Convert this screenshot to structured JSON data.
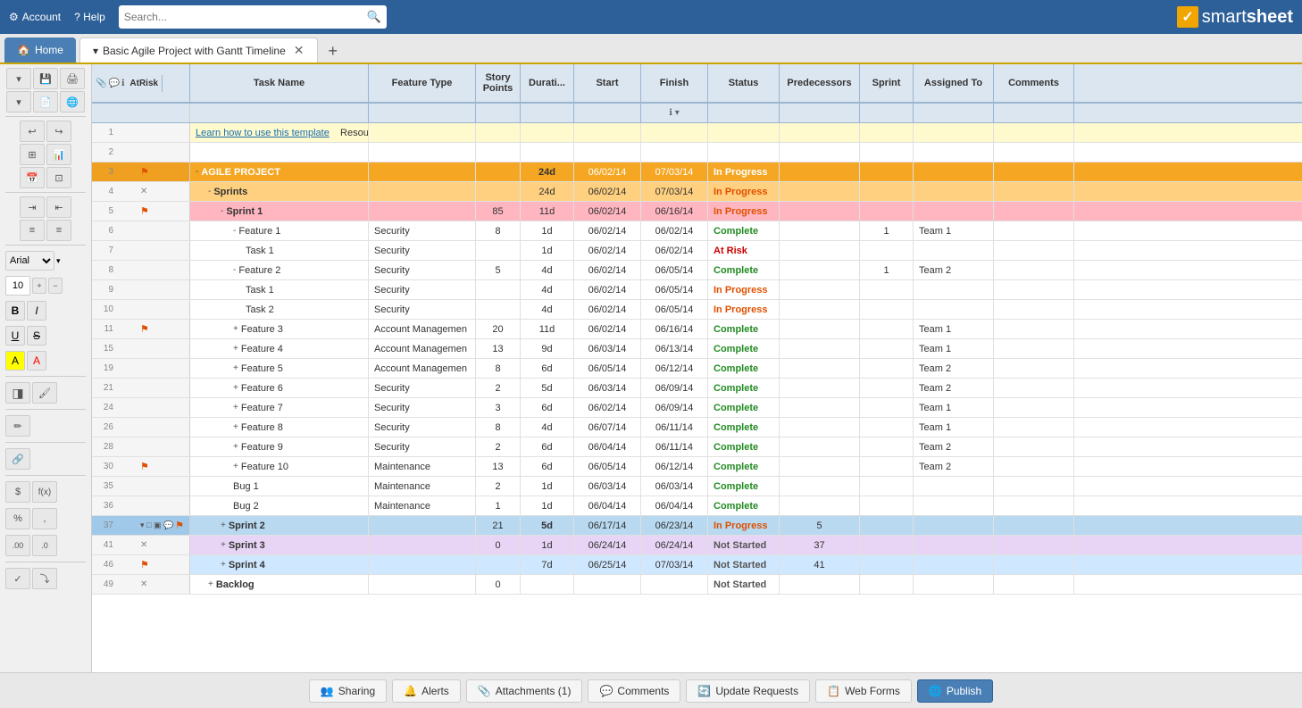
{
  "topbar": {
    "account_label": "Account",
    "help_label": "? Help",
    "search_placeholder": "Search...",
    "logo_text": "smartsheet",
    "logo_check": "✓"
  },
  "tabs": {
    "home_label": "Home",
    "sheet_label": "Basic Agile Project with Gantt Timeline",
    "add_label": "+"
  },
  "columns": {
    "at_risk": "At Risk",
    "task_name": "Task Name",
    "feature_type": "Feature Type",
    "story_points": "Story Points",
    "duration": "Durati...",
    "start": "Start",
    "finish": "Finish",
    "status": "Status",
    "predecessors": "Predecessors",
    "sprint": "Sprint",
    "assigned_to": "Assigned To",
    "comments": "Comments"
  },
  "rows": [
    {
      "num": 1,
      "indent": 0,
      "flag": false,
      "asterisk": false,
      "task": "Learn how to use this template",
      "task_link": true,
      "extra": "Resources",
      "feature": "",
      "story": "",
      "duration": "",
      "start": "",
      "finish": "",
      "status": "",
      "pred": "",
      "sprint": "",
      "assigned": "",
      "comments": "",
      "bg": "yellow"
    },
    {
      "num": 2,
      "indent": 0,
      "flag": false,
      "asterisk": false,
      "task": "",
      "feature": "",
      "story": "",
      "duration": "",
      "start": "",
      "finish": "",
      "status": "",
      "pred": "",
      "sprint": "",
      "assigned": "",
      "comments": "",
      "bg": ""
    },
    {
      "num": 3,
      "indent": 0,
      "flag": true,
      "asterisk": false,
      "task": "AGILE PROJECT",
      "expand": "-",
      "feature": "",
      "story": "",
      "duration": "24d",
      "start": "06/02/14",
      "finish": "07/03/14",
      "status": "In Progress",
      "pred": "",
      "sprint": "",
      "assigned": "",
      "comments": "",
      "bg": "orange"
    },
    {
      "num": 4,
      "indent": 1,
      "flag": false,
      "asterisk": true,
      "task": "Sprints",
      "expand": "-",
      "feature": "",
      "story": "",
      "duration": "24d",
      "start": "06/02/14",
      "finish": "07/03/14",
      "status": "In Progress",
      "pred": "",
      "sprint": "",
      "assigned": "",
      "comments": "",
      "bg": "orange-light"
    },
    {
      "num": 5,
      "indent": 2,
      "flag": true,
      "asterisk": false,
      "task": "Sprint 1",
      "expand": "-",
      "feature": "",
      "story": "85",
      "duration": "11d",
      "start": "06/02/14",
      "finish": "06/16/14",
      "status": "In Progress",
      "pred": "",
      "sprint": "",
      "assigned": "",
      "comments": "",
      "bg": "pink"
    },
    {
      "num": 6,
      "indent": 3,
      "flag": false,
      "asterisk": false,
      "task": "Feature 1",
      "expand": "-",
      "feature": "Security",
      "story": "8",
      "duration": "1d",
      "start": "06/02/14",
      "finish": "06/02/14",
      "status": "Complete",
      "pred": "",
      "sprint": "1",
      "assigned": "Team 1",
      "comments": "",
      "bg": ""
    },
    {
      "num": 7,
      "indent": 4,
      "flag": false,
      "asterisk": false,
      "task": "Task 1",
      "feature": "Security",
      "story": "",
      "duration": "1d",
      "start": "06/02/14",
      "finish": "06/02/14",
      "status": "At Risk",
      "pred": "",
      "sprint": "",
      "assigned": "",
      "comments": "",
      "bg": ""
    },
    {
      "num": 8,
      "indent": 3,
      "flag": false,
      "asterisk": false,
      "task": "Feature 2",
      "expand": "-",
      "feature": "Security",
      "story": "5",
      "duration": "4d",
      "start": "06/02/14",
      "finish": "06/05/14",
      "status": "Complete",
      "pred": "",
      "sprint": "1",
      "assigned": "Team 2",
      "comments": "",
      "bg": ""
    },
    {
      "num": 9,
      "indent": 4,
      "flag": false,
      "asterisk": false,
      "task": "Task 1",
      "feature": "Security",
      "story": "",
      "duration": "4d",
      "start": "06/02/14",
      "finish": "06/05/14",
      "status": "In Progress",
      "pred": "",
      "sprint": "",
      "assigned": "",
      "comments": "",
      "bg": ""
    },
    {
      "num": 10,
      "indent": 4,
      "flag": false,
      "asterisk": false,
      "task": "Task 2",
      "feature": "Security",
      "story": "",
      "duration": "4d",
      "start": "06/02/14",
      "finish": "06/05/14",
      "status": "In Progress",
      "pred": "",
      "sprint": "",
      "assigned": "",
      "comments": "",
      "bg": ""
    },
    {
      "num": 11,
      "indent": 3,
      "flag": true,
      "asterisk": false,
      "task": "Feature 3",
      "expand": "+",
      "feature": "Account Managemen",
      "story": "20",
      "duration": "11d",
      "start": "06/02/14",
      "finish": "06/16/14",
      "status": "Complete",
      "pred": "",
      "sprint": "",
      "assigned": "Team 1",
      "comments": "",
      "bg": ""
    },
    {
      "num": 15,
      "indent": 3,
      "flag": false,
      "asterisk": false,
      "task": "Feature 4",
      "expand": "+",
      "feature": "Account Managemen",
      "story": "13",
      "duration": "9d",
      "start": "06/03/14",
      "finish": "06/13/14",
      "status": "Complete",
      "pred": "",
      "sprint": "",
      "assigned": "Team 1",
      "comments": "",
      "bg": ""
    },
    {
      "num": 19,
      "indent": 3,
      "flag": false,
      "asterisk": false,
      "task": "Feature 5",
      "expand": "+",
      "feature": "Account Managemen",
      "story": "8",
      "duration": "6d",
      "start": "06/05/14",
      "finish": "06/12/14",
      "status": "Complete",
      "pred": "",
      "sprint": "",
      "assigned": "Team 2",
      "comments": "",
      "bg": ""
    },
    {
      "num": 21,
      "indent": 3,
      "flag": false,
      "asterisk": false,
      "task": "Feature 6",
      "expand": "+",
      "feature": "Security",
      "story": "2",
      "duration": "5d",
      "start": "06/03/14",
      "finish": "06/09/14",
      "status": "Complete",
      "pred": "",
      "sprint": "",
      "assigned": "Team 2",
      "comments": "",
      "bg": ""
    },
    {
      "num": 24,
      "indent": 3,
      "flag": false,
      "asterisk": false,
      "task": "Feature 7",
      "expand": "+",
      "feature": "Security",
      "story": "3",
      "duration": "6d",
      "start": "06/02/14",
      "finish": "06/09/14",
      "status": "Complete",
      "pred": "",
      "sprint": "",
      "assigned": "Team 1",
      "comments": "",
      "bg": ""
    },
    {
      "num": 26,
      "indent": 3,
      "flag": false,
      "asterisk": false,
      "task": "Feature 8",
      "expand": "+",
      "feature": "Security",
      "story": "8",
      "duration": "4d",
      "start": "06/07/14",
      "finish": "06/11/14",
      "status": "Complete",
      "pred": "",
      "sprint": "",
      "assigned": "Team 1",
      "comments": "",
      "bg": ""
    },
    {
      "num": 28,
      "indent": 3,
      "flag": false,
      "asterisk": false,
      "task": "Feature 9",
      "expand": "+",
      "feature": "Security",
      "story": "2",
      "duration": "6d",
      "start": "06/04/14",
      "finish": "06/11/14",
      "status": "Complete",
      "pred": "",
      "sprint": "",
      "assigned": "Team 2",
      "comments": "",
      "bg": ""
    },
    {
      "num": 30,
      "indent": 3,
      "flag": true,
      "asterisk": false,
      "task": "Feature 10",
      "expand": "+",
      "feature": "Maintenance",
      "story": "13",
      "duration": "6d",
      "start": "06/05/14",
      "finish": "06/12/14",
      "status": "Complete",
      "pred": "",
      "sprint": "",
      "assigned": "Team 2",
      "comments": "",
      "bg": ""
    },
    {
      "num": 35,
      "indent": 3,
      "flag": false,
      "asterisk": false,
      "task": "Bug 1",
      "feature": "Maintenance",
      "story": "2",
      "duration": "1d",
      "start": "06/03/14",
      "finish": "06/03/14",
      "status": "Complete",
      "pred": "",
      "sprint": "",
      "assigned": "",
      "comments": "",
      "bg": ""
    },
    {
      "num": 36,
      "indent": 3,
      "flag": false,
      "asterisk": false,
      "task": "Bug 2",
      "feature": "Maintenance",
      "story": "1",
      "duration": "1d",
      "start": "06/04/14",
      "finish": "06/04/14",
      "status": "Complete",
      "pred": "",
      "sprint": "",
      "assigned": "",
      "comments": "",
      "bg": ""
    },
    {
      "num": 37,
      "indent": 2,
      "flag": true,
      "asterisk": false,
      "task": "Sprint 2",
      "expand": "+",
      "feature": "",
      "story": "21",
      "duration": "5d",
      "start": "06/17/14",
      "finish": "06/23/14",
      "status": "In Progress",
      "pred": "5",
      "sprint": "",
      "assigned": "",
      "comments": "",
      "bg": "green",
      "selected": true
    },
    {
      "num": 41,
      "indent": 2,
      "flag": false,
      "asterisk": true,
      "task": "Sprint 3",
      "expand": "+",
      "feature": "",
      "story": "0",
      "duration": "1d",
      "start": "06/24/14",
      "finish": "06/24/14",
      "status": "Not Started",
      "pred": "37",
      "sprint": "",
      "assigned": "",
      "comments": "",
      "bg": "purple-light"
    },
    {
      "num": 46,
      "indent": 2,
      "flag": true,
      "asterisk": false,
      "task": "Sprint 4",
      "expand": "+",
      "feature": "",
      "story": "",
      "duration": "7d",
      "start": "06/25/14",
      "finish": "07/03/14",
      "status": "Not Started",
      "pred": "41",
      "sprint": "",
      "assigned": "",
      "comments": "",
      "bg": "blue-light"
    },
    {
      "num": 49,
      "indent": 1,
      "flag": false,
      "asterisk": true,
      "task": "Backlog",
      "expand": "+",
      "feature": "",
      "story": "0",
      "duration": "",
      "start": "",
      "finish": "",
      "status": "Not Started",
      "pred": "",
      "sprint": "",
      "assigned": "",
      "comments": "",
      "bg": ""
    }
  ],
  "bottom_buttons": [
    {
      "label": "Sharing",
      "icon": "👥",
      "name": "sharing-button"
    },
    {
      "label": "Alerts",
      "icon": "🔔",
      "name": "alerts-button"
    },
    {
      "label": "Attachments (1)",
      "icon": "📎",
      "name": "attachments-button"
    },
    {
      "label": "Comments",
      "icon": "💬",
      "name": "comments-button"
    },
    {
      "label": "Update Requests",
      "icon": "🔄",
      "name": "update-requests-button"
    },
    {
      "label": "Web Forms",
      "icon": "📋",
      "name": "web-forms-button"
    },
    {
      "label": "Publish",
      "icon": "🌐",
      "name": "publish-button",
      "primary": true
    }
  ],
  "toolbar": {
    "font_name": "Arial",
    "font_size": "10"
  }
}
